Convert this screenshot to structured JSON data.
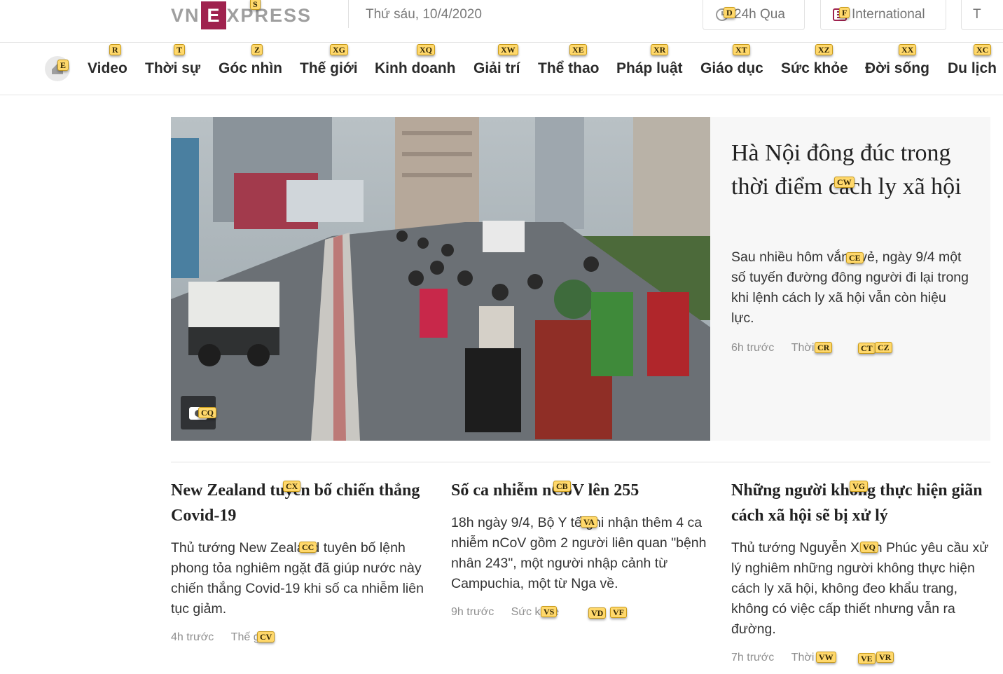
{
  "header": {
    "logo_left": "VN",
    "logo_mid": "E",
    "logo_right": "XPRESS",
    "date": "Thứ sáu, 10/4/2020",
    "btn_24h": "24h Qua",
    "btn_international": "International",
    "btn_more": "T"
  },
  "nav": {
    "items": [
      "Video",
      "Thời sự",
      "Góc nhìn",
      "Thế giới",
      "Kinh doanh",
      "Giải trí",
      "Thể thao",
      "Pháp luật",
      "Giáo dục",
      "Sức khỏe",
      "Đời sống",
      "Du lịch"
    ]
  },
  "hero": {
    "title": "Hà Nội đông đúc trong thời điểm cách ly xã hội",
    "lead": "Sau nhiều hôm vắng vẻ, ngày 9/4 một số tuyến đường đông người đi lại trong khi lệnh cách ly xã hội vẫn còn hiệu lực.",
    "time": "6h trước",
    "category": "Thời sự"
  },
  "cards": [
    {
      "title": "New Zealand tuyên bố chiến thắng Covid-19",
      "lead": "Thủ tướng New Zealand tuyên bố lệnh phong tỏa nghiêm ngặt đã giúp nước này chiến thắng Covid-19 khi số ca nhiễm liên tục giảm.",
      "time": "4h trước",
      "category": "Thế giới"
    },
    {
      "title": "Số ca nhiễm nCoV lên 255",
      "lead": "18h ngày 9/4, Bộ Y tế ghi nhận thêm 4 ca nhiễm nCoV gồm 2 người liên quan \"bệnh nhân 243\", một người nhập cảnh từ Campuchia, một từ Nga về.",
      "time": "9h trước",
      "category": "Sức khỏe"
    },
    {
      "title": "Những người không thực hiện giãn cách xã hội sẽ bị xử lý",
      "lead": "Thủ tướng Nguyễn Xuân Phúc yêu cầu xử lý nghiêm những người không thực hiện cách ly xã hội, không đeo khẩu trang, không có việc cấp thiết nhưng vẫn ra đường.",
      "time": "7h trước",
      "category": "Thời sự"
    }
  ],
  "hints": {
    "logo": "S",
    "btn_24h": "D",
    "btn_intl": "F",
    "home": "E",
    "nav": [
      "R",
      "T",
      "Z",
      "XG",
      "XQ",
      "XW",
      "XE",
      "XR",
      "XT",
      "XZ",
      "XX",
      "XC"
    ],
    "hero_title": "CW",
    "hero_lead": "CE",
    "hero_cat": "CR",
    "hero_share": "CT",
    "hero_comment": "CZ",
    "hero_cam": "CQ",
    "card1_title": "CX",
    "card1_lead": "CC",
    "card1_cat": "CV",
    "card2_title": "CB",
    "card2_lead": "VA",
    "card2_cat": "VS",
    "card2_share": "VD",
    "card2_comment": "VF",
    "card3_title": "VG",
    "card3_lead": "VQ",
    "card3_cat": "VW",
    "card3_share": "VE",
    "card3_comment": "VR"
  },
  "colors": {
    "brand": "#9f224e",
    "hint_bg": "#ffd86b",
    "text": "#222222",
    "meta": "#8f8f8f"
  }
}
